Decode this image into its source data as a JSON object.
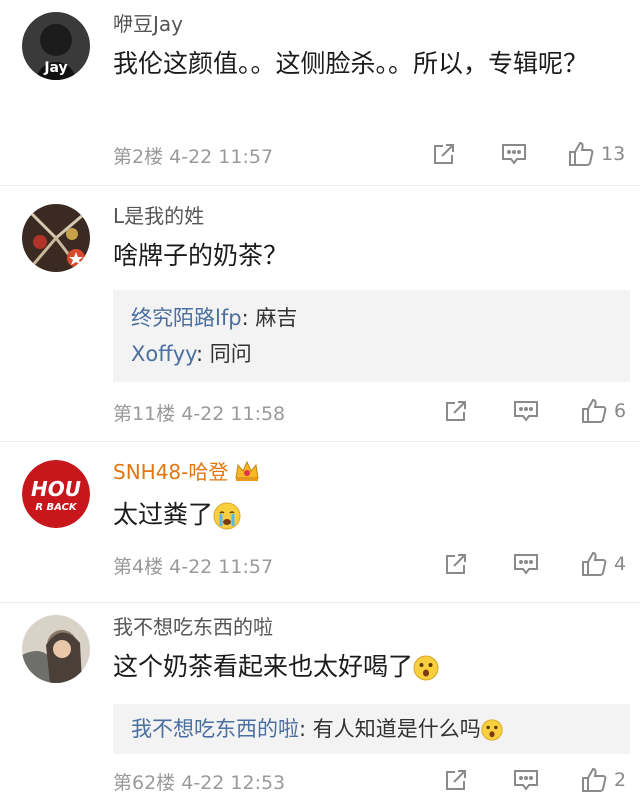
{
  "comments": [
    {
      "username": "咿豆Jay",
      "text": "我伦这颜值。。这侧脸杀。。所以，专辑呢？",
      "floor": "第2楼",
      "time": "4-22 11:57",
      "likes": "13",
      "avatar_label": "Jay",
      "replies": []
    },
    {
      "username": "L是我的姓",
      "text": "啥牌子的奶茶？",
      "floor": "第11楼",
      "time": "4-22 11:58",
      "likes": "6",
      "replies": [
        {
          "user": "终究陌路lfp",
          "sep": ": ",
          "text": "麻吉"
        },
        {
          "user": "Xoffyy",
          "sep": ": ",
          "text": "同问"
        }
      ]
    },
    {
      "username": "SNH48-哈登",
      "text": "太过粪了",
      "floor": "第4楼",
      "time": "4-22 11:57",
      "likes": "4",
      "avatar_label_top": "HOU",
      "avatar_label_bottom": "R BACK",
      "replies": []
    },
    {
      "username": "我不想吃东西的啦",
      "text": "这个奶茶看起来也太好喝了",
      "floor": "第62楼",
      "time": "4-22 12:53",
      "likes": "2",
      "replies": [
        {
          "user": "我不想吃东西的啦",
          "sep": ": ",
          "text": "有人知道是什么吗"
        }
      ]
    }
  ],
  "icons": {
    "share": "share-icon",
    "reply": "comment-reply-icon",
    "like": "thumbs-up-icon",
    "cry_emoji": "crying-emoji-icon",
    "surprise_emoji": "surprised-emoji-icon",
    "crown": "vip-crown-icon"
  },
  "colors": {
    "username_vip": "#e2760f",
    "reply_user": "#4a6fa0",
    "reply_bg": "#f3f3f3",
    "meta": "#9a9a9a"
  }
}
